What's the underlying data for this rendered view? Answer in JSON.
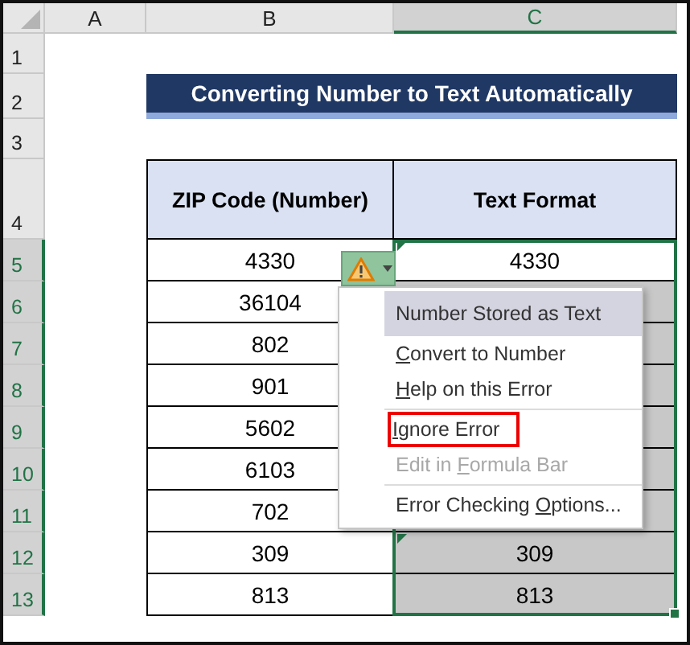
{
  "columns": [
    {
      "label": "A",
      "selected": false
    },
    {
      "label": "B",
      "selected": false
    },
    {
      "label": "C",
      "selected": true
    }
  ],
  "row_headers": [
    {
      "label": "1",
      "selected": false
    },
    {
      "label": "2",
      "selected": false
    },
    {
      "label": "3",
      "selected": false
    },
    {
      "label": "4",
      "selected": false
    },
    {
      "label": "5",
      "selected": true
    },
    {
      "label": "6",
      "selected": true
    },
    {
      "label": "7",
      "selected": true
    },
    {
      "label": "8",
      "selected": true
    },
    {
      "label": "9",
      "selected": true
    },
    {
      "label": "10",
      "selected": true
    },
    {
      "label": "11",
      "selected": true
    },
    {
      "label": "12",
      "selected": true
    },
    {
      "label": "13",
      "selected": true
    }
  ],
  "title": "Converting Number to Text Automatically",
  "table": {
    "columns": [
      "ZIP Code (Number)",
      "Text Format"
    ],
    "rows": [
      {
        "zip": "4330",
        "text": "4330",
        "selected": true,
        "active": true,
        "error_mark": true
      },
      {
        "zip": "36104",
        "selected": true,
        "active": false,
        "error_mark": false
      },
      {
        "zip": "802",
        "selected": true,
        "active": false,
        "error_mark": false
      },
      {
        "zip": "901",
        "selected": true,
        "active": false,
        "error_mark": false
      },
      {
        "zip": "5602",
        "selected": true,
        "active": false,
        "error_mark": false
      },
      {
        "zip": "6103",
        "selected": true,
        "active": false,
        "error_mark": false
      },
      {
        "zip": "702",
        "selected": true,
        "active": false,
        "error_mark": false
      },
      {
        "zip": "309",
        "text": "309",
        "selected": true,
        "active": false,
        "error_mark": true
      },
      {
        "zip": "813",
        "text": "813",
        "selected": true,
        "active": false,
        "error_mark": false
      }
    ]
  },
  "error_button": {
    "expanded": true
  },
  "menu": {
    "items": [
      {
        "kind": "header",
        "pre": "Number Stored as Text",
        "highlighted": false
      },
      {
        "kind": "item",
        "key": "C",
        "post": "onvert to Number",
        "highlighted": false
      },
      {
        "kind": "item",
        "key": "H",
        "post": "elp on this Error",
        "highlighted": false
      },
      {
        "kind": "separator"
      },
      {
        "kind": "item",
        "key": "I",
        "post": "gnore Error",
        "highlighted": true
      },
      {
        "kind": "disabled",
        "pre": "Edit in ",
        "key": "F",
        "post": "ormula Bar",
        "highlighted": false
      },
      {
        "kind": "separator"
      },
      {
        "kind": "item",
        "pre": "Error Checking ",
        "key": "O",
        "post": "ptions...",
        "highlighted": false
      }
    ]
  }
}
